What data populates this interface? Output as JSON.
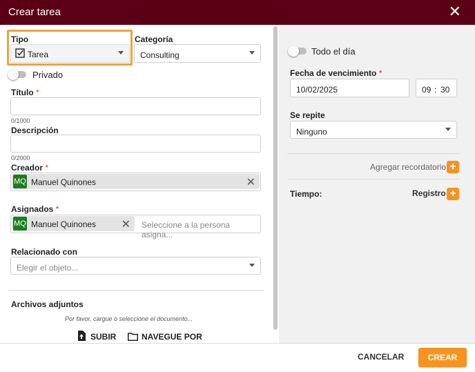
{
  "dialog": {
    "title": "Crear tarea"
  },
  "left": {
    "tipo": {
      "label": "Tipo",
      "value": "Tarea"
    },
    "categoria": {
      "label": "Categoría",
      "value": "Consulting"
    },
    "privado": {
      "label": "Privado"
    },
    "titulo": {
      "label": "Título",
      "required": "*",
      "counter": "0/1000"
    },
    "descripcion": {
      "label": "Descripción",
      "counter": "0/2000"
    },
    "creador": {
      "label": "Creador",
      "required": "*",
      "avatar": "MQ",
      "name": "Manuel Quinones"
    },
    "asignados": {
      "label": "Asignados",
      "required": "*",
      "avatar": "MQ",
      "name": "Manuel Quinones",
      "placeholder": "Seleccione a la persona asigna..."
    },
    "relacionado": {
      "label": "Relacionado con",
      "placeholder": "Elegir el objeto..."
    },
    "adjuntos": {
      "label": "Archivos adjuntos",
      "hint": "Por favor, cargue o seleccione el documento...",
      "upload": "SUBIR",
      "browse": "NAVEGUE POR"
    }
  },
  "right": {
    "todo_el_dia": {
      "label": "Todo el día"
    },
    "vencimiento": {
      "label": "Fecha de vencimiento",
      "required": "*",
      "date": "10/02/2025",
      "hour": "09",
      "sep": ":",
      "minute": "30"
    },
    "se_repite": {
      "label": "Se repite",
      "value": "Ninguno"
    },
    "recordatorio": {
      "label": "Agregar recordatorio"
    },
    "tiempo": {
      "label": "Tiempo:",
      "registro": "Registro"
    }
  },
  "footer": {
    "cancel": "CANCELAR",
    "create": "CREAR"
  },
  "colors": {
    "header": "#5b0014",
    "accent": "#f7931e",
    "avatar": "#1b7d1b",
    "highlight": "#f0a040"
  }
}
